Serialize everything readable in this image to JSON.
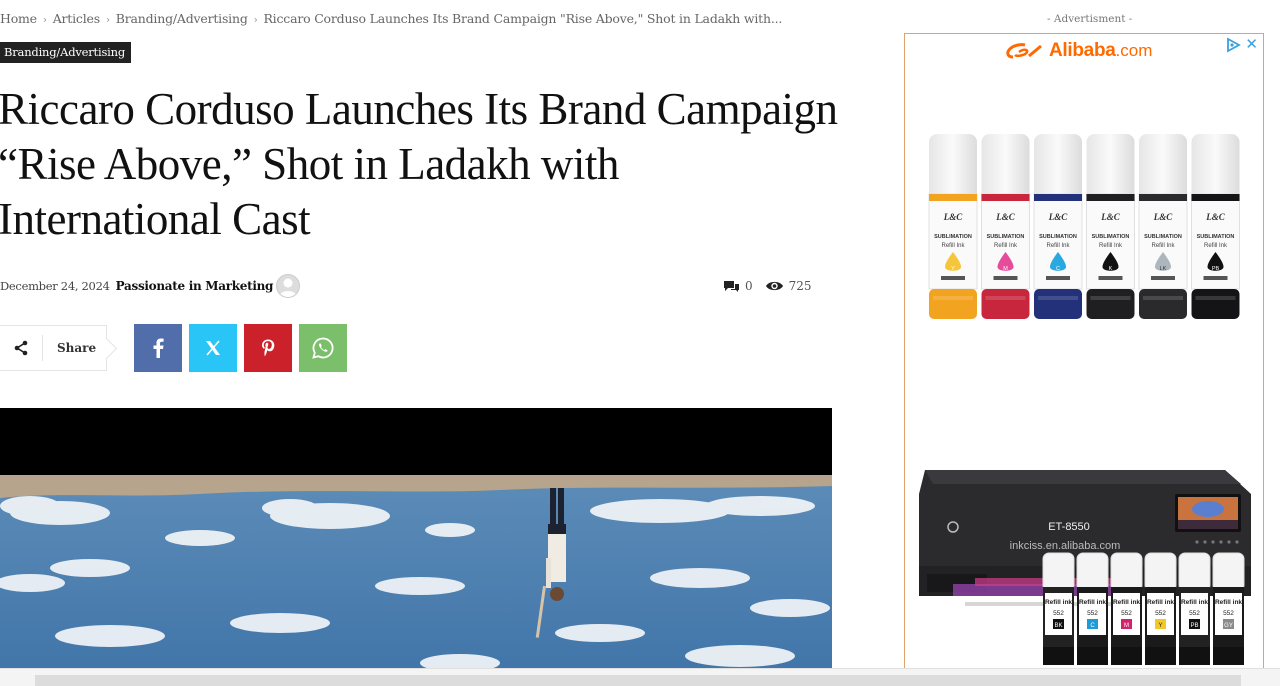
{
  "breadcrumb": {
    "items": [
      "Home",
      "Articles",
      "Branding/Advertising",
      "Riccaro Corduso Launches Its Brand Campaign \"Rise Above,\" Shot in Ladakh with..."
    ],
    "separator": "›"
  },
  "article": {
    "category": "Branding/Advertising",
    "title": "Riccaro Corduso Launches Its Brand Campaign “Rise Above,” Shot in Ladakh with International Cast",
    "date": "December 24, 2024",
    "author": "Passionate in Marketing",
    "comments": "0",
    "views": "725"
  },
  "share": {
    "label": "Share",
    "buttons": [
      "facebook-icon",
      "x-icon",
      "pinterest-icon",
      "whatsapp-icon"
    ]
  },
  "ad": {
    "label": "- Advertisment -",
    "brand": "Alibaba",
    "tld": ".com",
    "ink_label_brand": "L&C",
    "ink_label_line1": "SUBLIMATION",
    "ink_label_line2": "Refill Ink",
    "printer_model": "ET-8550",
    "printer_url": "inkciss.en.alibaba.com",
    "refill_label": "Refill ink",
    "refill_number": "552",
    "ink_codes_top": [
      "Y",
      "M",
      "C",
      "K",
      "LK",
      "PB"
    ],
    "ink_codes_bottom": [
      "BK",
      "C",
      "M",
      "Y",
      "PB",
      "GY"
    ]
  },
  "colors": {
    "badge_bg": "#222222",
    "facebook": "#516eab",
    "x": "#29c5f6",
    "pinterest": "#ca212a",
    "whatsapp": "#7bbf6a",
    "alibaba": "#ff6a00"
  }
}
